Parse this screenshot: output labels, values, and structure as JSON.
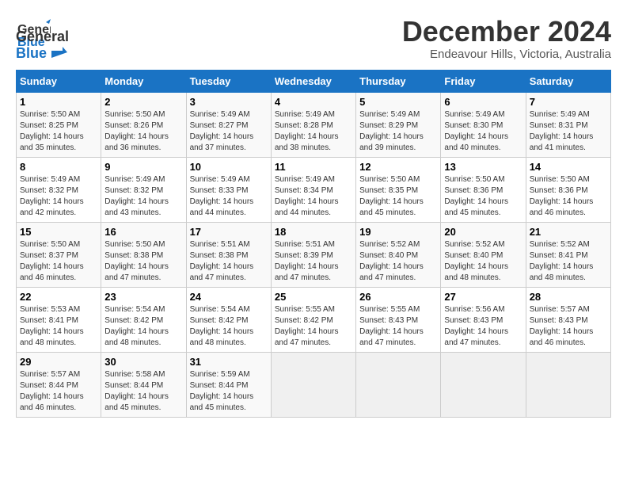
{
  "logo": {
    "line1": "General",
    "line2": "Blue"
  },
  "header": {
    "month": "December 2024",
    "location": "Endeavour Hills, Victoria, Australia"
  },
  "weekdays": [
    "Sunday",
    "Monday",
    "Tuesday",
    "Wednesday",
    "Thursday",
    "Friday",
    "Saturday"
  ],
  "weeks": [
    [
      {
        "day": "1",
        "sunrise": "5:50 AM",
        "sunset": "8:25 PM",
        "daylight": "14 hours and 35 minutes."
      },
      {
        "day": "2",
        "sunrise": "5:50 AM",
        "sunset": "8:26 PM",
        "daylight": "14 hours and 36 minutes."
      },
      {
        "day": "3",
        "sunrise": "5:49 AM",
        "sunset": "8:27 PM",
        "daylight": "14 hours and 37 minutes."
      },
      {
        "day": "4",
        "sunrise": "5:49 AM",
        "sunset": "8:28 PM",
        "daylight": "14 hours and 38 minutes."
      },
      {
        "day": "5",
        "sunrise": "5:49 AM",
        "sunset": "8:29 PM",
        "daylight": "14 hours and 39 minutes."
      },
      {
        "day": "6",
        "sunrise": "5:49 AM",
        "sunset": "8:30 PM",
        "daylight": "14 hours and 40 minutes."
      },
      {
        "day": "7",
        "sunrise": "5:49 AM",
        "sunset": "8:31 PM",
        "daylight": "14 hours and 41 minutes."
      }
    ],
    [
      {
        "day": "8",
        "sunrise": "5:49 AM",
        "sunset": "8:32 PM",
        "daylight": "14 hours and 42 minutes."
      },
      {
        "day": "9",
        "sunrise": "5:49 AM",
        "sunset": "8:32 PM",
        "daylight": "14 hours and 43 minutes."
      },
      {
        "day": "10",
        "sunrise": "5:49 AM",
        "sunset": "8:33 PM",
        "daylight": "14 hours and 44 minutes."
      },
      {
        "day": "11",
        "sunrise": "5:49 AM",
        "sunset": "8:34 PM",
        "daylight": "14 hours and 44 minutes."
      },
      {
        "day": "12",
        "sunrise": "5:50 AM",
        "sunset": "8:35 PM",
        "daylight": "14 hours and 45 minutes."
      },
      {
        "day": "13",
        "sunrise": "5:50 AM",
        "sunset": "8:36 PM",
        "daylight": "14 hours and 45 minutes."
      },
      {
        "day": "14",
        "sunrise": "5:50 AM",
        "sunset": "8:36 PM",
        "daylight": "14 hours and 46 minutes."
      }
    ],
    [
      {
        "day": "15",
        "sunrise": "5:50 AM",
        "sunset": "8:37 PM",
        "daylight": "14 hours and 46 minutes."
      },
      {
        "day": "16",
        "sunrise": "5:50 AM",
        "sunset": "8:38 PM",
        "daylight": "14 hours and 47 minutes."
      },
      {
        "day": "17",
        "sunrise": "5:51 AM",
        "sunset": "8:38 PM",
        "daylight": "14 hours and 47 minutes."
      },
      {
        "day": "18",
        "sunrise": "5:51 AM",
        "sunset": "8:39 PM",
        "daylight": "14 hours and 47 minutes."
      },
      {
        "day": "19",
        "sunrise": "5:52 AM",
        "sunset": "8:40 PM",
        "daylight": "14 hours and 47 minutes."
      },
      {
        "day": "20",
        "sunrise": "5:52 AM",
        "sunset": "8:40 PM",
        "daylight": "14 hours and 48 minutes."
      },
      {
        "day": "21",
        "sunrise": "5:52 AM",
        "sunset": "8:41 PM",
        "daylight": "14 hours and 48 minutes."
      }
    ],
    [
      {
        "day": "22",
        "sunrise": "5:53 AM",
        "sunset": "8:41 PM",
        "daylight": "14 hours and 48 minutes."
      },
      {
        "day": "23",
        "sunrise": "5:54 AM",
        "sunset": "8:42 PM",
        "daylight": "14 hours and 48 minutes."
      },
      {
        "day": "24",
        "sunrise": "5:54 AM",
        "sunset": "8:42 PM",
        "daylight": "14 hours and 48 minutes."
      },
      {
        "day": "25",
        "sunrise": "5:55 AM",
        "sunset": "8:42 PM",
        "daylight": "14 hours and 47 minutes."
      },
      {
        "day": "26",
        "sunrise": "5:55 AM",
        "sunset": "8:43 PM",
        "daylight": "14 hours and 47 minutes."
      },
      {
        "day": "27",
        "sunrise": "5:56 AM",
        "sunset": "8:43 PM",
        "daylight": "14 hours and 47 minutes."
      },
      {
        "day": "28",
        "sunrise": "5:57 AM",
        "sunset": "8:43 PM",
        "daylight": "14 hours and 46 minutes."
      }
    ],
    [
      {
        "day": "29",
        "sunrise": "5:57 AM",
        "sunset": "8:44 PM",
        "daylight": "14 hours and 46 minutes."
      },
      {
        "day": "30",
        "sunrise": "5:58 AM",
        "sunset": "8:44 PM",
        "daylight": "14 hours and 45 minutes."
      },
      {
        "day": "31",
        "sunrise": "5:59 AM",
        "sunset": "8:44 PM",
        "daylight": "14 hours and 45 minutes."
      },
      null,
      null,
      null,
      null
    ]
  ]
}
